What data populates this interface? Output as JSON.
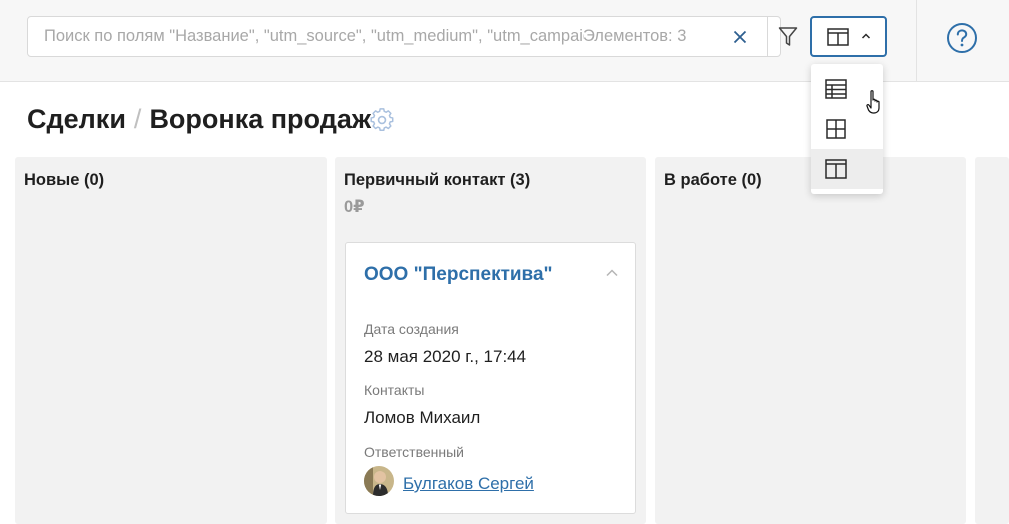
{
  "search": {
    "placeholder": "Поиск по полям \"Название\", \"utm_source\", \"utm_medium\", \"utm_campaign\"",
    "value": "",
    "count_text": "Элементов: 3"
  },
  "breadcrumb": {
    "root": "Сделки",
    "separator": "/",
    "current": "Воронка продаж"
  },
  "view_menu": {
    "items": [
      {
        "icon": "table-view-icon"
      },
      {
        "icon": "grid-view-icon"
      },
      {
        "icon": "kanban-view-icon",
        "selected": true
      }
    ]
  },
  "columns": [
    {
      "title": "Новые (0)",
      "sum": ""
    },
    {
      "title": "Первичный контакт (3)",
      "sum": "0₽"
    },
    {
      "title": "В работе (0)",
      "sum": ""
    }
  ],
  "card": {
    "title": "ООО \"Перспектива\"",
    "created_label": "Дата создания",
    "created_value": "28 мая 2020 г., 17:44",
    "contacts_label": "Контакты",
    "contacts_value": "Ломов Михаил",
    "responsible_label": "Ответственный",
    "responsible_value": "Булгаков Сергей"
  },
  "colors": {
    "accent": "#2e6fa9",
    "column_bg": "#f2f2f2",
    "topbar_bg": "#f7f7f7"
  }
}
